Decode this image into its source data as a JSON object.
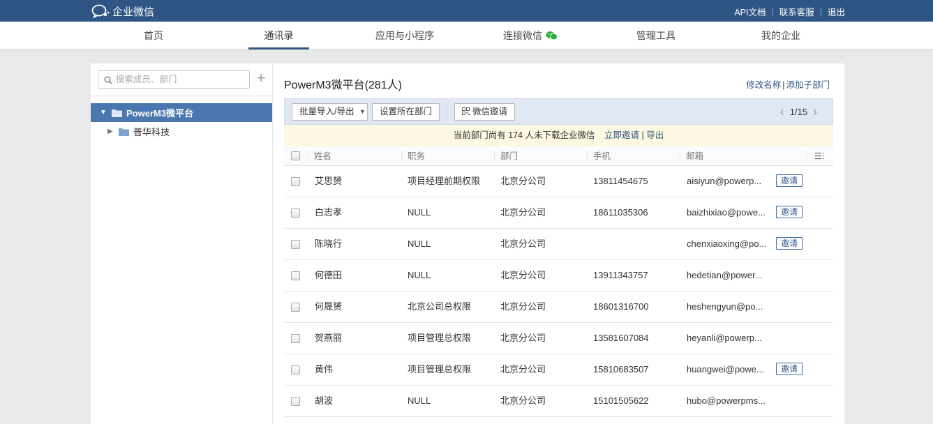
{
  "app": {
    "name": "企业微信",
    "top_links": [
      "API文档",
      "联系客服",
      "退出"
    ]
  },
  "nav": {
    "items": [
      "首页",
      "通讯录",
      "应用与小程序",
      "连接微信",
      "管理工具",
      "我的企业"
    ],
    "active": "通讯录"
  },
  "sidebar": {
    "search_placeholder": "搜索成员、部门",
    "tree": [
      {
        "label": "PowerM3微平台",
        "expanded": true,
        "selected": true
      },
      {
        "label": "普华科技",
        "expanded": false,
        "selected": false
      }
    ]
  },
  "department": {
    "title": "PowerM3微平台(281人)",
    "rename_label": "修改名称",
    "add_sub_label": "添加子部门"
  },
  "toolbar": {
    "import_export_label": "批量导入/导出",
    "set_dept_label": "设置所在部门",
    "wechat_invite_label": "微信邀请",
    "pager_text": "1/15"
  },
  "notice": {
    "text": "当前部门尚有 174 人未下载企业微信",
    "invite_now": "立即邀请",
    "export": "导出"
  },
  "table": {
    "columns": [
      "姓名",
      "职务",
      "部门",
      "手机",
      "邮箱"
    ],
    "invite_label": "邀请",
    "rows": [
      {
        "name": "艾思赟",
        "title": "项目经理前期权限",
        "dept": "北京分公司",
        "phone": "13811454675",
        "email": "aisiyun@powerp...",
        "invite": true
      },
      {
        "name": "白志孝",
        "title": "NULL",
        "dept": "北京分公司",
        "phone": "18611035306",
        "email": "baizhixiao@powe...",
        "invite": true
      },
      {
        "name": "陈晓行",
        "title": "NULL",
        "dept": "北京分公司",
        "phone": "",
        "email": "chenxiaoxing@po...",
        "invite": true
      },
      {
        "name": "何德田",
        "title": "NULL",
        "dept": "北京分公司",
        "phone": "13911343757",
        "email": "hedetian@power...",
        "invite": false
      },
      {
        "name": "何晟赟",
        "title": "北京公司总权限",
        "dept": "北京分公司",
        "phone": "18601316700",
        "email": "heshengyun@po...",
        "invite": false
      },
      {
        "name": "贺燕丽",
        "title": "项目管理总权限",
        "dept": "北京分公司",
        "phone": "13581607084",
        "email": "heyanli@powerp...",
        "invite": false
      },
      {
        "name": "黄伟",
        "title": "项目管理总权限",
        "dept": "北京分公司",
        "phone": "15810683507",
        "email": "huangwei@powe...",
        "invite": true
      },
      {
        "name": "胡波",
        "title": "NULL",
        "dept": "北京分公司",
        "phone": "15101505622",
        "email": "hubo@powerpms...",
        "invite": false
      }
    ]
  }
}
